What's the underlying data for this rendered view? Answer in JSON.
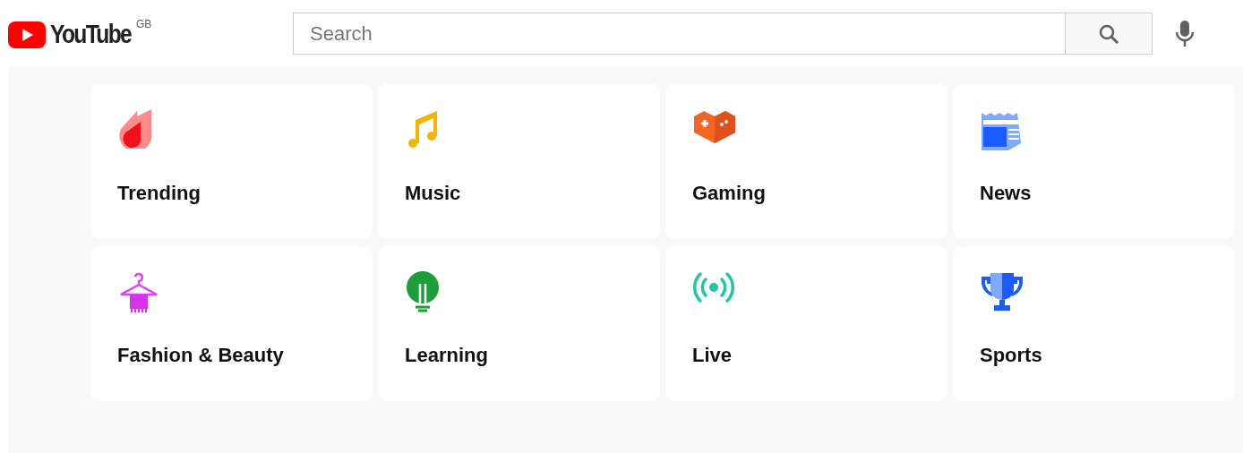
{
  "header": {
    "logo_text": "YouTube",
    "region": "GB",
    "search": {
      "placeholder": "Search"
    }
  },
  "categories": [
    {
      "label": "Trending",
      "kind": "flame"
    },
    {
      "label": "Music",
      "kind": "music"
    },
    {
      "label": "Gaming",
      "kind": "gaming"
    },
    {
      "label": "News",
      "kind": "news"
    },
    {
      "label": "Fashion & Beauty",
      "kind": "hanger"
    },
    {
      "label": "Learning",
      "kind": "bulb"
    },
    {
      "label": "Live",
      "kind": "live"
    },
    {
      "label": "Sports",
      "kind": "trophy"
    }
  ]
}
